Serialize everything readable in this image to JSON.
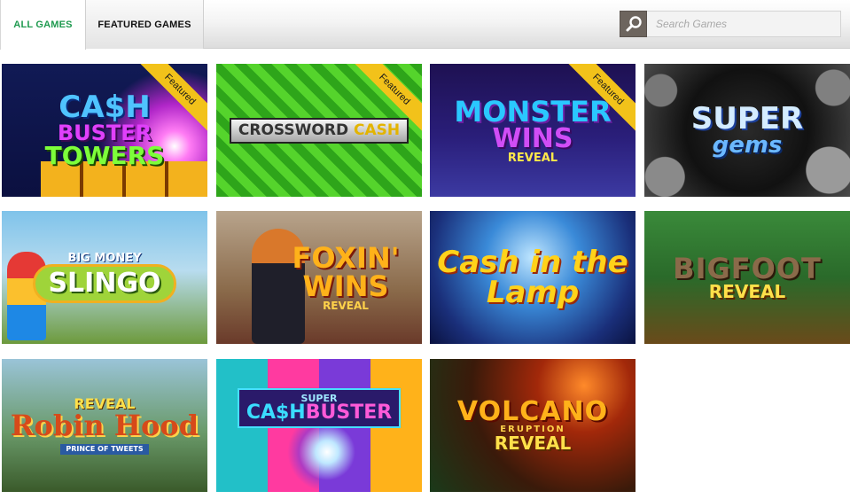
{
  "tabs": [
    {
      "label": "ALL GAMES",
      "active": true
    },
    {
      "label": "FEATURED GAMES",
      "active": false
    }
  ],
  "search": {
    "placeholder": "Search Games",
    "value": "",
    "icon": "magnifier-icon"
  },
  "games": [
    {
      "line1": "CA$H",
      "line2": "BUSTER",
      "line3": "TOWERS",
      "featured": true,
      "badge": "Featured"
    },
    {
      "line1": "CROSSWORD",
      "line2": "CASH",
      "featured": true,
      "badge": "Featured"
    },
    {
      "line1": "MONSTER",
      "line2": "WINS",
      "line3": "REVEAL",
      "featured": true,
      "badge": "Featured"
    },
    {
      "line1": "SUPER",
      "line2": "gems",
      "featured": false
    },
    {
      "line1": "BIG MONEY",
      "line2": "SLINGO",
      "featured": false
    },
    {
      "line1": "FOXIN' WINS",
      "line2": "REVEAL",
      "featured": false
    },
    {
      "line1": "Cash in the Lamp",
      "line2": "",
      "featured": false
    },
    {
      "line1": "BIGFOOT",
      "line2": "REVEAL",
      "featured": false
    },
    {
      "line0": "REVEAL",
      "line1": "Robin Hood",
      "line2": "PRINCE OF TWEETS",
      "featured": false
    },
    {
      "line1": "SUPER",
      "line2a": "CA$H",
      "line2b": "BUSTER",
      "featured": false
    },
    {
      "line1": "VOLCANO",
      "line2": "ERUPTION",
      "line3": "REVEAL",
      "featured": false
    }
  ],
  "colors": {
    "active_tab_text": "#1f9a4f",
    "search_button": "#6d655e",
    "featured_ribbon": "#f2c21a"
  }
}
